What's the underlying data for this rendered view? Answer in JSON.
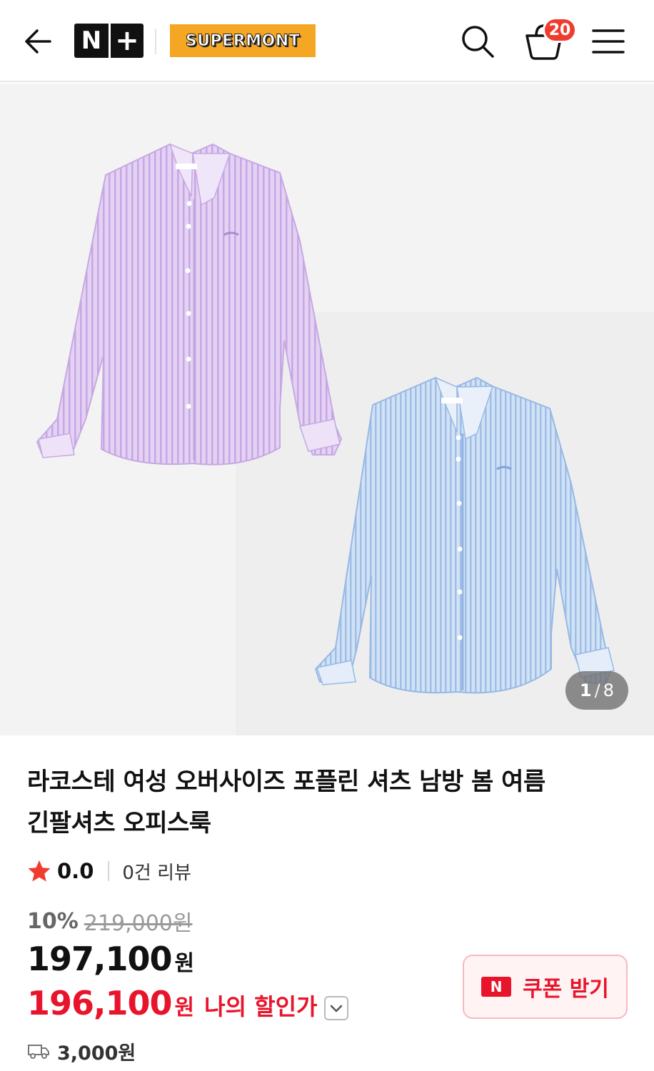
{
  "header": {
    "back_icon": "arrow-left-icon",
    "nplus_logo_n": "N",
    "nplus_logo_plus": "+",
    "store_logo": "SUPERMONT",
    "search_icon": "search-icon",
    "cart_icon": "shopping-basket-icon",
    "cart_count": "20",
    "menu_icon": "hamburger-menu-icon"
  },
  "gallery": {
    "current_page": "1",
    "separator": "/",
    "total_pages": "8"
  },
  "product": {
    "title_line1": "라코스테 여성 오버사이즈 포플린 셔츠 남방 봄 여름",
    "title_line2": "긴팔셔츠 오피스룩",
    "rating": "0.0",
    "review_count": "0건 리뷰",
    "discount_rate": "10%",
    "original_price": "219,000원",
    "sale_price": "197,100",
    "sale_price_unit": "원",
    "my_price": "196,100",
    "my_price_unit": "원",
    "my_price_label": "나의 할인가",
    "coupon_badge": "N",
    "coupon_label": "쿠폰 받기",
    "shipping_fee": "3,000원"
  },
  "colors": {
    "accent_red": "#e8142b",
    "badge_red": "#f03c2e",
    "store_orange": "#f5a623",
    "shirt_lilac": "#d9c2ee",
    "shirt_blue": "#bcd3ef"
  }
}
